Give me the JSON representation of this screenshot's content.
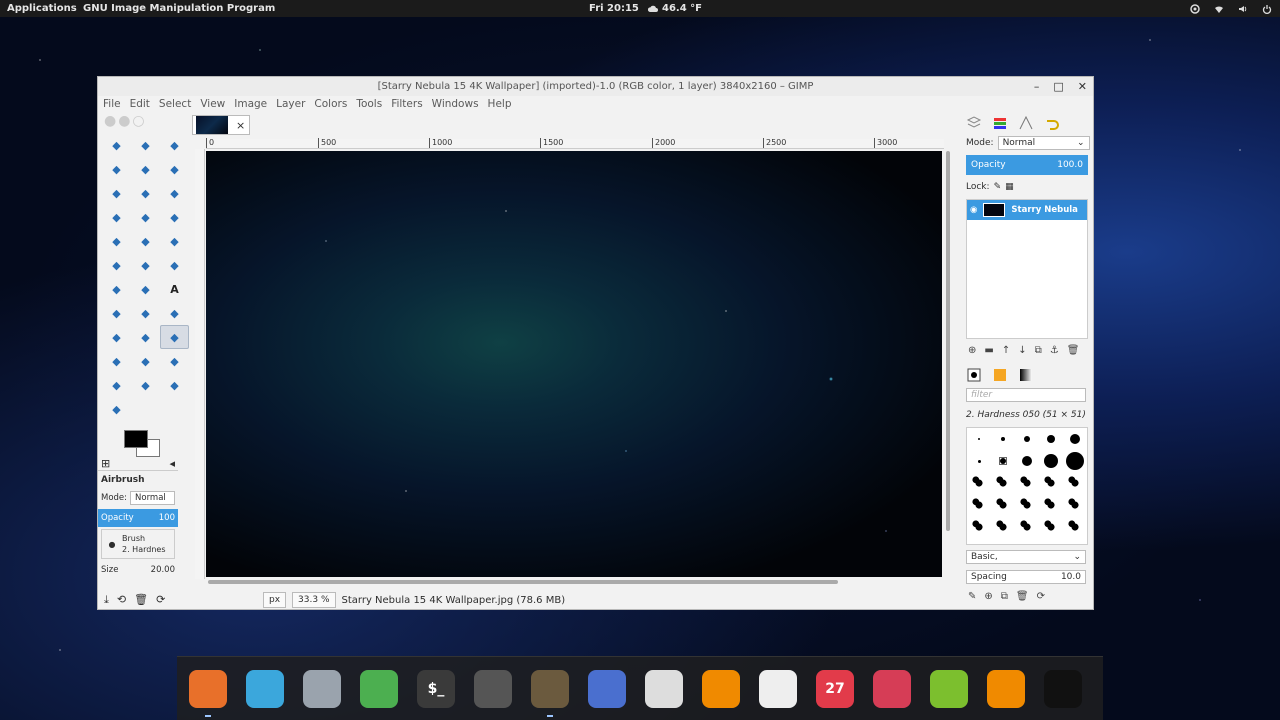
{
  "topbar": {
    "applications": "Applications",
    "active_app": "GNU Image Manipulation Program",
    "clock": "Fri 20:15",
    "weather": "46.4 °F"
  },
  "window": {
    "title": "[Starry Nebula 15 4K Wallpaper] (imported)-1.0 (RGB color, 1 layer) 3840x2160 – GIMP",
    "menu": [
      "File",
      "Edit",
      "Select",
      "View",
      "Image",
      "Layer",
      "Colors",
      "Tools",
      "Filters",
      "Windows",
      "Help"
    ]
  },
  "toolbox": {
    "tools": [
      "rect-select",
      "ellipse-select",
      "free-select",
      "fuzzy-select",
      "color-select",
      "scissors-select",
      "foreground-select",
      "paths",
      "color-picker",
      "zoom",
      "measure",
      "move",
      "align",
      "crop",
      "rotate",
      "scale",
      "shear",
      "perspective",
      "flip",
      "cage",
      "text",
      "bucket-fill",
      "blend",
      "pencil",
      "paintbrush",
      "eraser",
      "airbrush",
      "ink",
      "clone",
      "heal",
      "perspective-clone",
      "blur",
      "smudge",
      "dodge-burn"
    ],
    "active_tool": "airbrush"
  },
  "tool_options": {
    "title": "Airbrush",
    "mode_label": "Mode:",
    "mode_value": "Normal",
    "opacity_label": "Opacity",
    "opacity_value": "100",
    "brush_label": "Brush",
    "brush_value": "2. Hardnes",
    "size_label": "Size",
    "size_value": "20.00"
  },
  "image_tab": {
    "close": "×"
  },
  "ruler": {
    "ticks": [
      "0",
      "500",
      "1000",
      "1500",
      "2000",
      "2500",
      "3000"
    ]
  },
  "status": {
    "unit": "px",
    "zoom": "33.3 %",
    "file": "Starry Nebula 15 4K Wallpaper.jpg (78.6 MB)"
  },
  "layers_dock": {
    "mode_label": "Mode:",
    "mode_value": "Normal",
    "opacity_label": "Opacity",
    "opacity_value": "100.0",
    "lock_label": "Lock:",
    "layer_name": "Starry Nebula"
  },
  "brushes_dock": {
    "filter_placeholder": "filter",
    "selected_brush": "2. Hardness 050 (51 × 51)",
    "preset": "Basic,",
    "spacing_label": "Spacing",
    "spacing_value": "10.0"
  },
  "dock_apps": [
    {
      "name": "firefox",
      "color": "#e8702a"
    },
    {
      "name": "files",
      "color": "#3ba7dc"
    },
    {
      "name": "archive-manager",
      "color": "#9aa3ad"
    },
    {
      "name": "settings",
      "color": "#4caf50"
    },
    {
      "name": "terminal",
      "color": "#3a3a3a",
      "label": "$_"
    },
    {
      "name": "video",
      "color": "#555"
    },
    {
      "name": "gimp",
      "color": "#6b5a3e"
    },
    {
      "name": "text-editor",
      "color": "#4a6fcf"
    },
    {
      "name": "writer",
      "color": "#ddd"
    },
    {
      "name": "vlc",
      "color": "#f08a00"
    },
    {
      "name": "calculator",
      "color": "#eee"
    },
    {
      "name": "calendar",
      "color": "#e23b4a",
      "label": "27"
    },
    {
      "name": "mixer",
      "color": "#d63d56"
    },
    {
      "name": "music",
      "color": "#7cbf2e"
    },
    {
      "name": "sync",
      "color": "#f08a00"
    },
    {
      "name": "app-grid",
      "color": "#111"
    }
  ]
}
